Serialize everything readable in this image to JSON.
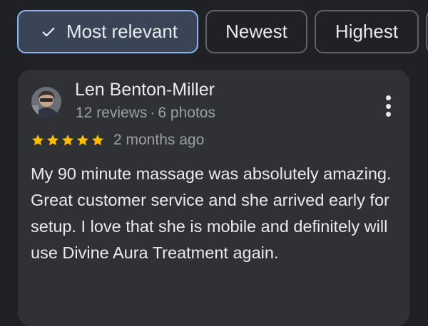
{
  "filters": [
    {
      "label": "Most relevant",
      "selected": true
    },
    {
      "label": "Newest",
      "selected": false
    },
    {
      "label": "Highest",
      "selected": false
    }
  ],
  "review": {
    "author": "Len Benton-Miller",
    "reviews_count": "12 reviews",
    "photos_count": "6 photos",
    "rating": 5,
    "max_rating": 5,
    "time": "2 months ago",
    "text": "My 90 minute massage was absolutely amazing. Great customer service and she arrived early for setup. I love that she is mobile and definitely will use Divine Aura Treatment again."
  },
  "colors": {
    "background": "#202124",
    "card": "#303134",
    "selected_chip": "#394457",
    "selected_border": "#8ab4f8",
    "star": "#fbbc04"
  },
  "icons": {
    "check": "check-icon",
    "more": "more-vert-icon",
    "star": "star-icon"
  }
}
